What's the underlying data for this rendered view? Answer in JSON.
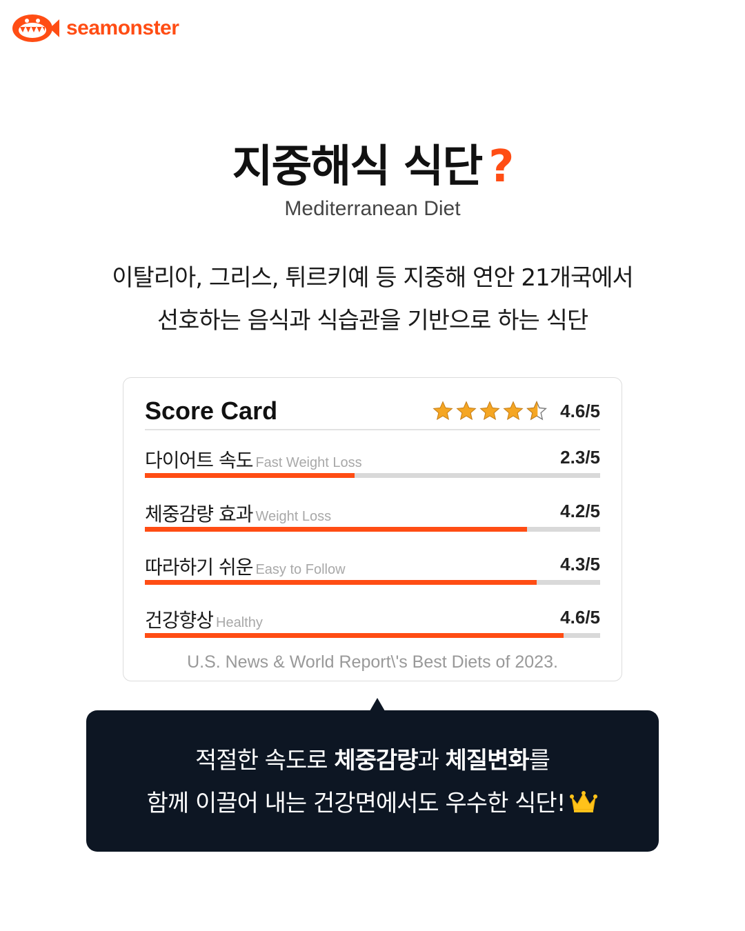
{
  "brand": {
    "name": "seamonster",
    "color": "#ff4d14"
  },
  "headline": {
    "title": "지중해식 식단",
    "mark": "?"
  },
  "subtitle": "Mediterranean Diet",
  "description": {
    "line1": "이탈리아, 그리스, 튀르키예 등 지중해 연안 21개국에서",
    "line2": "선호하는 음식과 식습관을 기반으로 하는 식단"
  },
  "score_card": {
    "title": "Score Card",
    "overall": {
      "value": 4.6,
      "max": 5,
      "label": "4.6/5",
      "stars_full": 4,
      "stars_half": 1
    },
    "items": [
      {
        "label": "다이어트 속도",
        "en": "Fast Weight Loss",
        "score": "2.3/5",
        "value": 2.3
      },
      {
        "label": "체중감량 효과",
        "en": "Weight Loss",
        "score": "4.2/5",
        "value": 4.2
      },
      {
        "label": "따라하기 쉬운",
        "en": "Easy to Follow",
        "score": "4.3/5",
        "value": 4.3
      },
      {
        "label": "건강향상",
        "en": "Healthy",
        "score": "4.6/5",
        "value": 4.6
      }
    ],
    "source": "U.S. News & World Report\\'s Best Diets of 2023."
  },
  "callout": {
    "line1_a": "적절한 속도로 ",
    "line1_b": "체중감량",
    "line1_c": "과 ",
    "line1_d": "체질변화",
    "line1_e": "를",
    "line2": "함께 이끌어 내는 건강면에서도 우수한 식단!",
    "icon": "crown-icon"
  },
  "colors": {
    "accent": "#ff4d14",
    "star": "#f5a623",
    "dark": "#0d1623",
    "track": "#d9d9d9"
  }
}
